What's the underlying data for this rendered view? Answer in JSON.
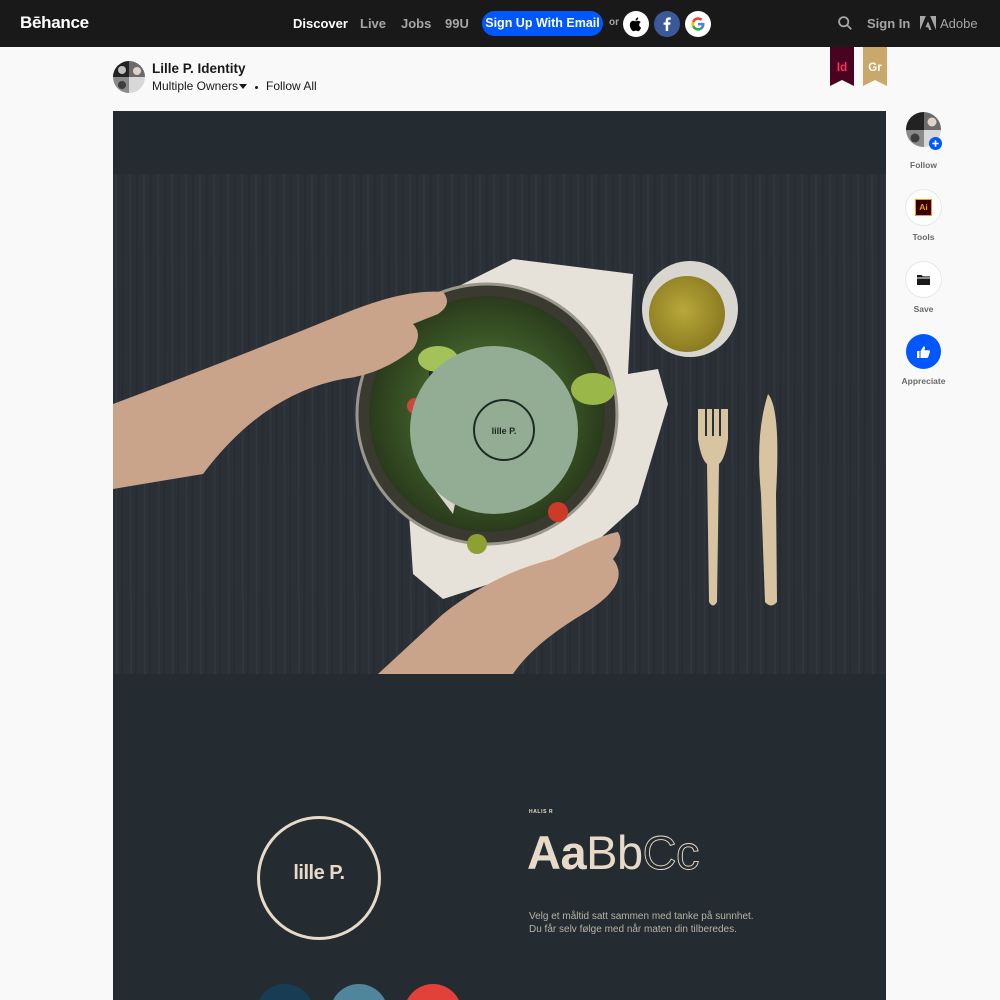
{
  "nav": {
    "logo": "Bēhance",
    "links": [
      "Discover",
      "Live",
      "Jobs",
      "99U"
    ],
    "signup_label": "Sign Up With Email",
    "or_label": "or",
    "social": [
      "apple-icon",
      "facebook-icon",
      "google-icon"
    ],
    "signin_label": "Sign In",
    "adobe_label": "Adobe"
  },
  "project": {
    "title": "Lille P. Identity",
    "owners_label": "Multiple Owners",
    "follow_all_label": "Follow All",
    "ribbons": [
      {
        "label": "Id",
        "bg": "#49021f",
        "fg": "#ff3366"
      },
      {
        "label": "Gr",
        "bg": "#c9a86a",
        "fg": "#ffffff"
      }
    ]
  },
  "artwork": {
    "lid_label": "lille P.",
    "brand_label": "lille P.",
    "font_name": "HALIS R",
    "font_sample_bold": "Aa",
    "font_sample_regular": "Bb",
    "font_sample_light": "Cc",
    "body_lines": [
      "Velg et måltid satt sammen med tanke på sunnhet.",
      "Du får selv følge med når maten din tilberedes."
    ],
    "swatches": [
      "#173c54",
      "#4f869c",
      "#e2413a"
    ]
  },
  "rail": {
    "follow_label": "Follow",
    "tools_label": "Tools",
    "tools_icon_text": "Ai",
    "save_label": "Save",
    "appreciate_label": "Appreciate"
  },
  "colors": {
    "accent": "#0057ff",
    "nav_bg": "#191919",
    "canvas_bg": "#252c31",
    "brand_cream": "#e8dac8"
  }
}
